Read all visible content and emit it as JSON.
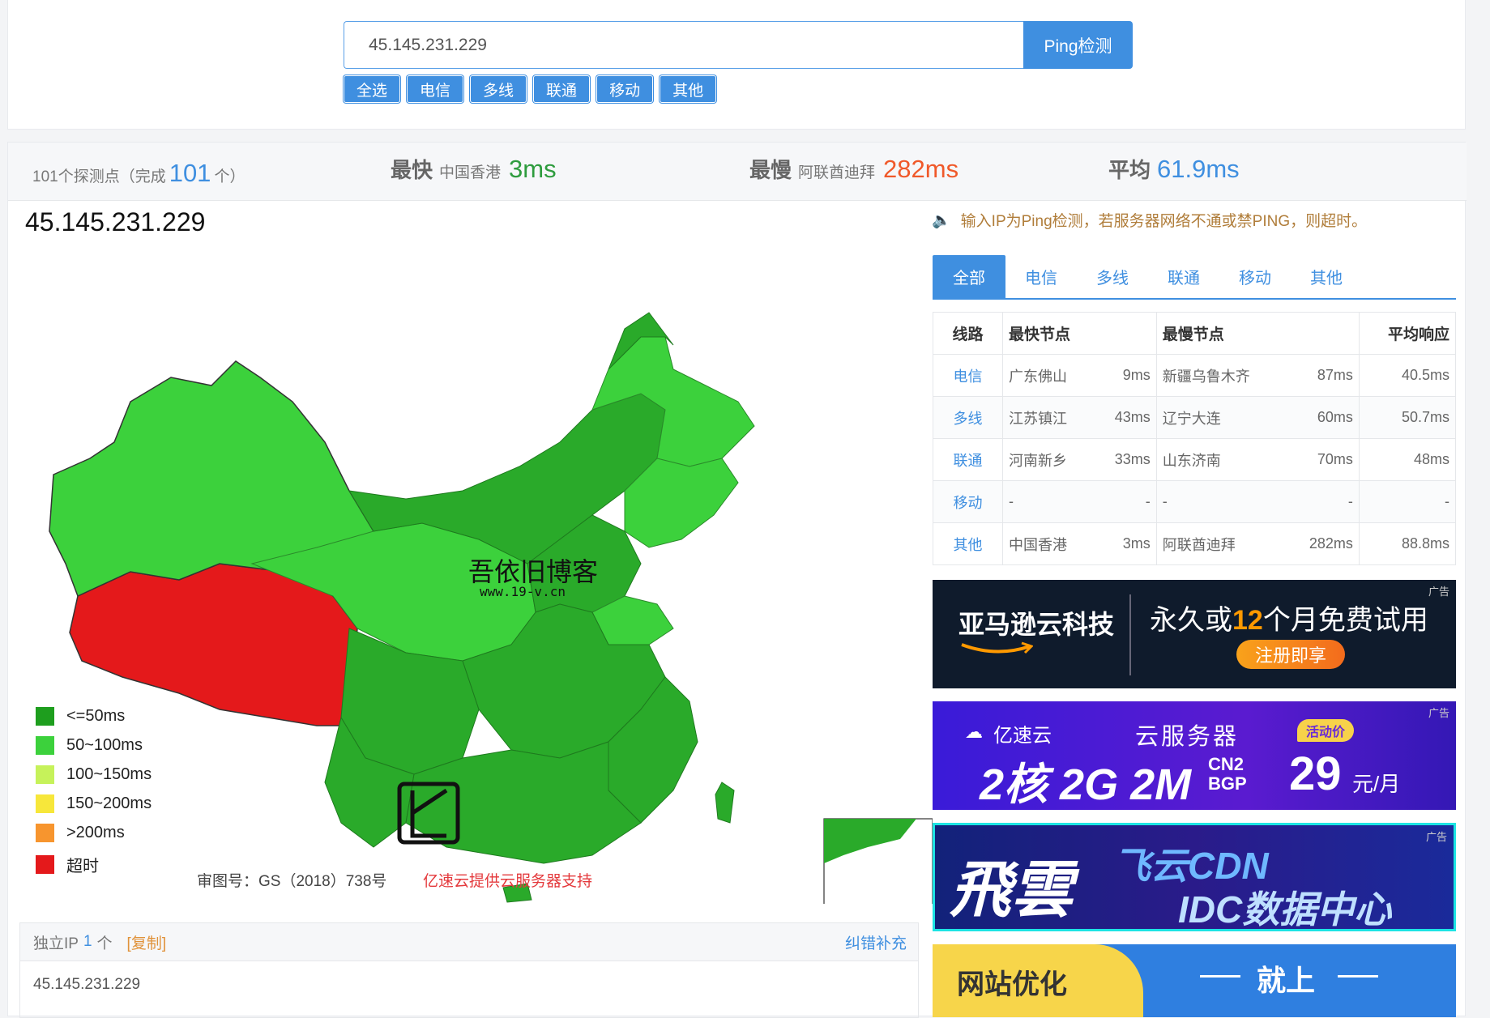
{
  "search": {
    "value": "45.145.231.229",
    "button": "Ping检测"
  },
  "filters": [
    "全选",
    "电信",
    "多线",
    "联通",
    "移动",
    "其他"
  ],
  "stats": {
    "probe_prefix": "101个探测点（完成",
    "probe_done": "101",
    "probe_suffix": "个）",
    "fastest_label": "最快",
    "fastest_node": "中国香港",
    "fastest_value": "3ms",
    "slowest_label": "最慢",
    "slowest_node": "阿联酋迪拜",
    "slowest_value": "282ms",
    "avg_label": "平均",
    "avg_value": "61.9ms"
  },
  "map": {
    "title": "45.145.231.229",
    "watermark_name": "吾依旧博客",
    "watermark_url": "www.19-v.cn",
    "review_no": "审图号：GS（2018）738号",
    "support": "亿速云提供云服务器支持",
    "legend": [
      {
        "label": "<=50ms",
        "color": "#1e9e1e"
      },
      {
        "label": "50~100ms",
        "color": "#3cd13c"
      },
      {
        "label": "100~150ms",
        "color": "#c6f25a"
      },
      {
        "label": "150~200ms",
        "color": "#f7e73a"
      },
      {
        "label": ">200ms",
        "color": "#f7952e"
      },
      {
        "label": "超时",
        "color": "#e4191b"
      }
    ]
  },
  "ip_panel": {
    "label": "独立IP",
    "count": "1",
    "unit": "个",
    "copy": "[复制]",
    "fix": "纠错补充",
    "ip": "45.145.231.229"
  },
  "notice": "输入IP为Ping检测，若服务器网络不通或禁PING，则超时。",
  "tabs": [
    "全部",
    "电信",
    "多线",
    "联通",
    "移动",
    "其他"
  ],
  "table": {
    "headers": [
      "线路",
      "最快节点",
      "最慢节点",
      "平均响应"
    ],
    "rows": [
      {
        "isp": "电信",
        "fast": "广东佛山",
        "fast_ms": "9ms",
        "slow": "新疆乌鲁木齐",
        "slow_ms": "87ms",
        "avg": "40.5ms"
      },
      {
        "isp": "多线",
        "fast": "江苏镇江",
        "fast_ms": "43ms",
        "slow": "辽宁大连",
        "slow_ms": "60ms",
        "avg": "50.7ms"
      },
      {
        "isp": "联通",
        "fast": "河南新乡",
        "fast_ms": "33ms",
        "slow": "山东济南",
        "slow_ms": "70ms",
        "avg": "48ms"
      },
      {
        "isp": "移动",
        "fast": "-",
        "fast_ms": "-",
        "slow": "-",
        "slow_ms": "-",
        "avg": "-"
      },
      {
        "isp": "其他",
        "fast": "中国香港",
        "fast_ms": "3ms",
        "slow": "阿联酋迪拜",
        "slow_ms": "282ms",
        "avg": "88.8ms"
      }
    ]
  },
  "ads": {
    "tag": "广告",
    "aws_brand": "亚马逊云科技",
    "aws_text_1": "永久或",
    "aws_text_num": "12",
    "aws_text_2": "个月免费试用",
    "aws_btn": "注册即享",
    "yisu_brand": "亿速云",
    "yisu_title": "云服务器",
    "yisu_badge": "活动价",
    "yisu_spec": "2核 2G 2M",
    "yisu_cn2_1": "CN2",
    "yisu_cn2_2": "BGP",
    "yisu_price": "29",
    "yisu_unit": "元/月",
    "feiyun_brand": "飛雲",
    "feiyun_1": "飞云CDN",
    "feiyun_2": "IDC数据中心",
    "web_1": "网站优化",
    "web_2": "就上"
  }
}
